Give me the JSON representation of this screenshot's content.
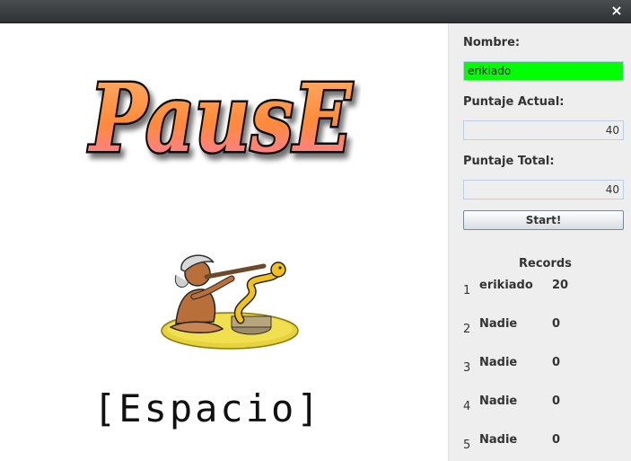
{
  "titlebar": {
    "close_glyph": "×"
  },
  "game": {
    "pause_text": "PausE",
    "espacio_label": "[Espacio]",
    "charmer_image": "snake-charmer-icon"
  },
  "panel": {
    "nombre_label": "Nombre:",
    "nombre_value": "erikiado",
    "puntaje_actual_label": "Puntaje Actual:",
    "puntaje_actual_value": "40",
    "puntaje_total_label": "Puntaje Total:",
    "puntaje_total_value": "40",
    "start_label": "Start!",
    "records_title": "Records",
    "records": [
      {
        "rank": "1",
        "name": "erikiado",
        "score": "20"
      },
      {
        "rank": "2",
        "name": "Nadie",
        "score": "0"
      },
      {
        "rank": "3",
        "name": "Nadie",
        "score": "0"
      },
      {
        "rank": "4",
        "name": "Nadie",
        "score": "0"
      },
      {
        "rank": "5",
        "name": "Nadie",
        "score": "0"
      }
    ]
  },
  "colors": {
    "nombre_bg": "#00ff00",
    "pause_fill": "#ff9a4a",
    "pause_outline": "#111111"
  }
}
